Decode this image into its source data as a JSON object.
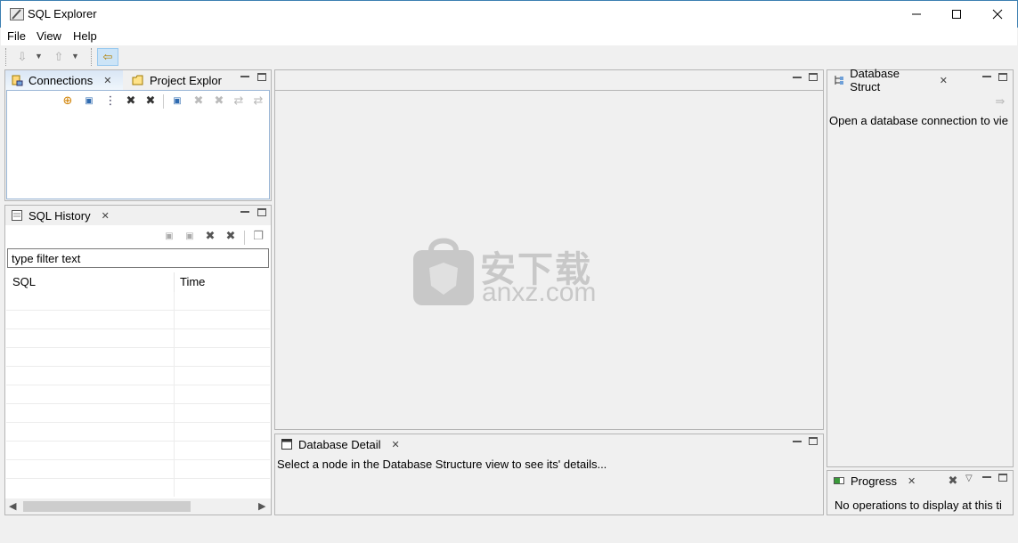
{
  "window": {
    "title": "SQL Explorer"
  },
  "menu": {
    "items": [
      "File",
      "View",
      "Help"
    ]
  },
  "connections_panel": {
    "tabs": [
      {
        "label": "Connections"
      },
      {
        "label": "Project Explor"
      }
    ]
  },
  "history_panel": {
    "tab_label": "SQL History",
    "filter_placeholder": "type filter text",
    "filter_value": "type filter text",
    "columns": [
      "SQL",
      "Time"
    ]
  },
  "db_structure_panel": {
    "tab_label": "Database Struct",
    "message": "Open a database connection to vie"
  },
  "db_detail_panel": {
    "tab_label": "Database Detail",
    "message": "Select a node in the Database Structure view to see its' details..."
  },
  "progress_panel": {
    "tab_label": "Progress",
    "message": "No operations to display at this ti"
  },
  "watermark": {
    "text_cn": "安下载",
    "text_en": "anxz.com"
  },
  "colors": {
    "accent": "#d9e6f5",
    "border": "#b5b5b5",
    "watermark": "#c8c8c8"
  }
}
